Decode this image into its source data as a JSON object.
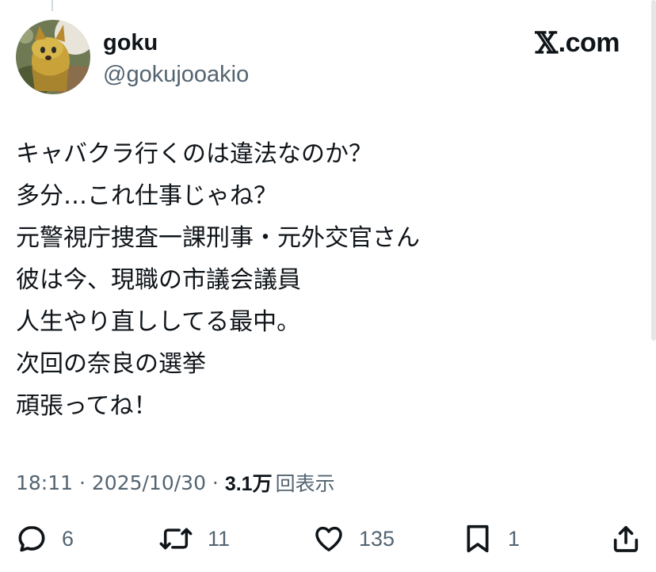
{
  "author": {
    "display_name": "goku",
    "handle": "@gokujooakio"
  },
  "brand": {
    "logo_letter": "𝕏",
    "domain": ".com"
  },
  "tweet": {
    "lines": [
      "キャバクラ行くのは違法なのか？",
      "多分…これ仕事じゃね？",
      "元警視庁捜査一課刑事・元外交官さん",
      "彼は今、現職の市議会議員",
      "人生やり直ししてる最中。",
      "次回の奈良の選挙",
      "頑張ってね！"
    ]
  },
  "meta": {
    "time": "18:11",
    "separator": " · ",
    "date": "2025/10/30",
    "separator2": " · ",
    "views_count": "3.1万",
    "views_label": "回表示"
  },
  "actions": {
    "reply": {
      "icon": "reply-icon",
      "count": "6"
    },
    "repost": {
      "icon": "repost-icon",
      "count": "11"
    },
    "like": {
      "icon": "heart-icon",
      "count": "135"
    },
    "bookmark": {
      "icon": "bookmark-icon",
      "count": "1"
    },
    "share": {
      "icon": "share-icon"
    }
  },
  "colors": {
    "text": "#0f1419",
    "secondary": "#536471",
    "background": "#ffffff"
  }
}
